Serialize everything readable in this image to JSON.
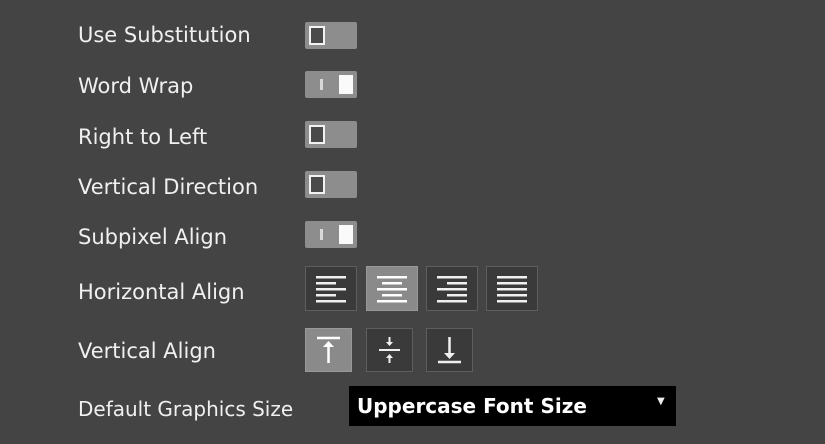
{
  "settings": [
    {
      "label": "Use Substitution",
      "value": "off"
    },
    {
      "label": "Word Wrap",
      "value": "on"
    },
    {
      "label": "Right to Left",
      "value": "off"
    },
    {
      "label": "Vertical Direction",
      "value": "off"
    },
    {
      "label": "Subpixel Align",
      "value": "on"
    }
  ],
  "horizontal_align": {
    "label": "Horizontal Align",
    "options": [
      "left-align-icon",
      "center-align-icon",
      "right-align-icon",
      "justify-align-icon"
    ],
    "selected": "center"
  },
  "vertical_align": {
    "label": "Vertical Align",
    "options": [
      "align-top-icon",
      "align-middle-icon",
      "align-bottom-icon"
    ],
    "selected": "top"
  },
  "default_graphics_size": {
    "label": "Default Graphics Size",
    "value": "Uppercase Font Size"
  },
  "colors": {
    "panel_bg": "#444444",
    "toggle_track": "#8d8d8d",
    "selected_button": "#8a8a8a",
    "dropdown_bg": "#000000"
  }
}
